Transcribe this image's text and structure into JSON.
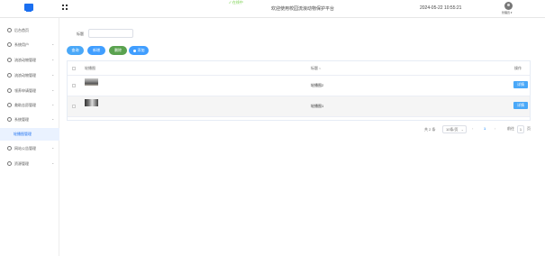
{
  "header": {
    "status_chip": "✓ 在线中",
    "welcome": "欢迎使用校园流浪动物保护平台",
    "datetime": "2024-05-22 10:55:21",
    "user_name": "管理员 ▾"
  },
  "sidebar": {
    "items": [
      {
        "label": "后台首页",
        "arrow": ""
      },
      {
        "label": "系统用户",
        "arrow": "⌄"
      },
      {
        "label": "流浪动物管理",
        "arrow": "⌄"
      },
      {
        "label": "流浪动物管理",
        "arrow": "⌄"
      },
      {
        "label": "领养申请管理",
        "arrow": "⌄"
      },
      {
        "label": "救助志愿管理",
        "arrow": "⌄"
      },
      {
        "label": "系统管理",
        "arrow": "⌄"
      },
      {
        "label": "轮播图管理",
        "arrow": ""
      },
      {
        "label": "网站公告管理",
        "arrow": "⌄"
      },
      {
        "label": "资源管理",
        "arrow": "⌄"
      }
    ]
  },
  "filter": {
    "label": "标题",
    "input_value": "",
    "placeholder": ""
  },
  "toolbar": {
    "search_label": "查询",
    "add_label": "新增",
    "delete_label": "删除",
    "batch_label": "添加"
  },
  "table": {
    "headers": {
      "image": "轮播图",
      "title": "标题",
      "action": "操作"
    },
    "rows": [
      {
        "title": "轮播图2",
        "action": "详情"
      },
      {
        "title": "轮播图1",
        "action": "详情"
      }
    ]
  },
  "pagination": {
    "total": "共 2 条",
    "page_size": "10条/页",
    "current_page": "1",
    "prev": "‹",
    "next": "›",
    "goto_label": "前往",
    "goto_value": "1",
    "goto_suffix": "页"
  },
  "colors": {
    "accent": "#409eff",
    "success": "#5aa24f",
    "info": "#4aa8f8"
  }
}
